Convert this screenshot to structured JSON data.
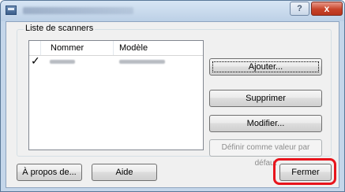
{
  "window": {
    "title": ""
  },
  "titlebar": {
    "help_label": "?",
    "close_label": "x"
  },
  "group": {
    "label": "Liste de scanners",
    "columns": {
      "name": "Nommer",
      "model": "Modèle"
    },
    "rows": [
      {
        "checked": "✓"
      }
    ]
  },
  "buttons": {
    "add": "Ajouter...",
    "delete": "Supprimer",
    "modify": "Modifier...",
    "set_default": "Définir comme valeur par défaut",
    "about": "À propos de...",
    "help": "Aide",
    "close": "Fermer"
  },
  "colors": {
    "highlight": "#e8141c",
    "close_button": "#c7432a"
  }
}
